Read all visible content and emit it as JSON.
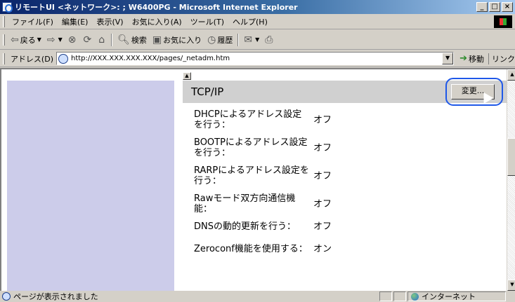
{
  "window": {
    "title": "リモートUI <ネットワーク>: ; W6400PG - Microsoft Internet Explorer",
    "buttons": [
      "_",
      "□",
      "×"
    ]
  },
  "menu": [
    "ファイル(F)",
    "編集(E)",
    "表示(V)",
    "お気に入り(A)",
    "ツール(T)",
    "ヘルプ(H)"
  ],
  "toolbar": {
    "back": "戻る",
    "search": "検索",
    "favorites": "お気に入り",
    "history": "履歴"
  },
  "address": {
    "label": "アドレス(D)",
    "url": "http://XXX.XXX.XXX.XXX/pages/_netadm.htm",
    "go": "移動",
    "links": "リンク"
  },
  "section": {
    "title": "TCP/IP",
    "change_label": "変更...",
    "rows": [
      {
        "label": "DHCPによるアドレス設定を行う：",
        "value": "オフ"
      },
      {
        "label": "BOOTPによるアドレス設定を行う：",
        "value": "オフ"
      },
      {
        "label": "RARPによるアドレス設定を行う：",
        "value": "オフ"
      },
      {
        "label": "Rawモード双方向通信機能：",
        "value": "オフ"
      },
      {
        "label": "DNSの動的更新を行う：",
        "value": "オフ"
      },
      {
        "label": "Zeroconf機能を使用する：",
        "value": "オン"
      }
    ]
  },
  "status": {
    "text": "ページが表示されました",
    "zone": "インターネット"
  }
}
